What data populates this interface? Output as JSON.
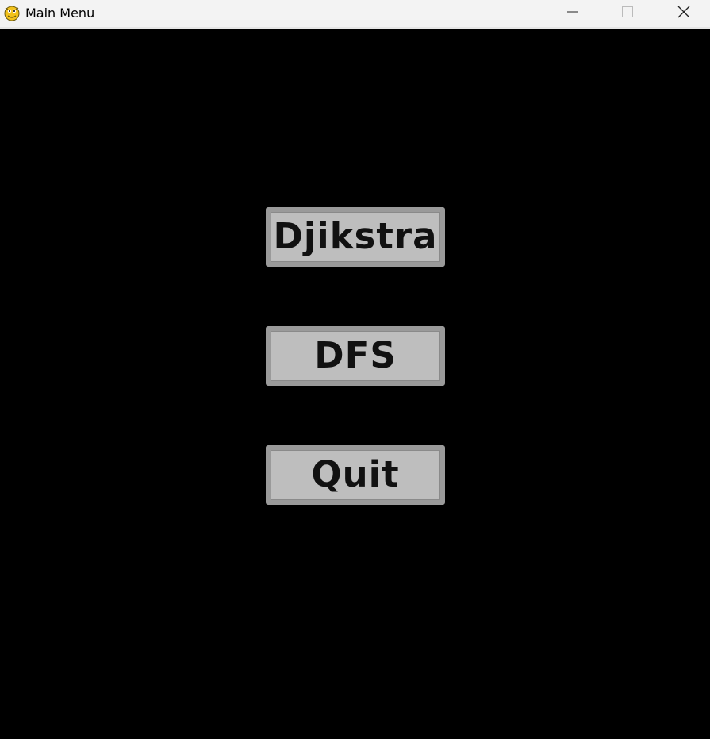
{
  "window": {
    "title": "Main Menu",
    "app_icon": "pygame-snake-icon"
  },
  "controls": {
    "minimize_icon": "minimize-icon",
    "maximize_icon": "maximize-icon",
    "close_icon": "close-icon"
  },
  "menu": {
    "buttons": [
      {
        "label": "Djikstra"
      },
      {
        "label": "DFS"
      },
      {
        "label": "Quit"
      }
    ]
  },
  "colors": {
    "background": "#000000",
    "button_face": "#bebebe",
    "button_border": "#9a9a9a",
    "button_text": "#111111",
    "titlebar": "#f3f3f3"
  }
}
